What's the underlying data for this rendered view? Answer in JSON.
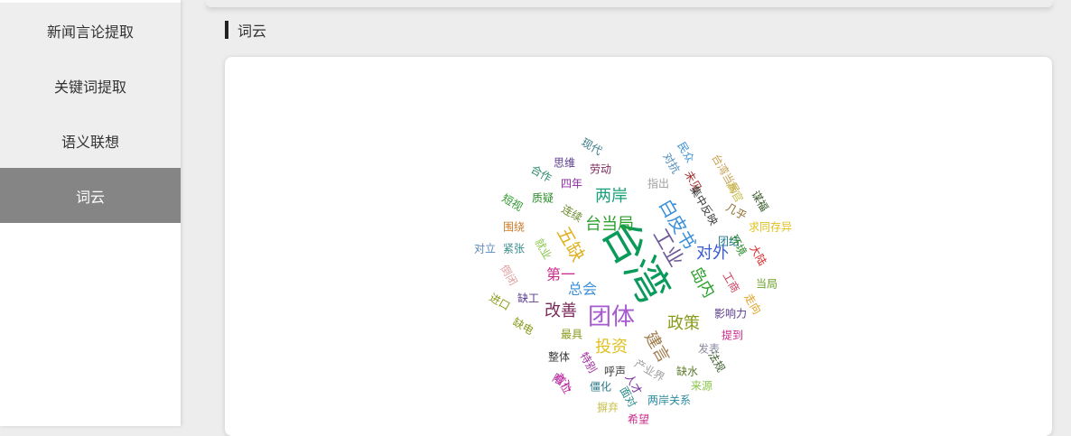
{
  "sidebar": {
    "items": [
      {
        "label": "新闻言论提取"
      },
      {
        "label": "关键词提取"
      },
      {
        "label": "语义联想"
      },
      {
        "label": "词云"
      }
    ]
  },
  "section": {
    "title": "词云"
  },
  "wordcloud": {
    "words": [
      "台湾",
      "团体",
      "工业",
      "白皮书",
      "台当局",
      "两岸",
      "五缺",
      "对外",
      "岛内",
      "政策",
      "建言",
      "投资",
      "改善",
      "总会",
      "第一",
      "现代",
      "民众",
      "思维",
      "劳动",
      "对抗",
      "未见",
      "合作",
      "四年",
      "指出",
      "台湾当局",
      "质疑",
      "集中反映",
      "高官",
      "谋福",
      "短视",
      "连续",
      "几乎",
      "团结",
      "求同存异",
      "围绕",
      "环境",
      "大陆",
      "对立",
      "紧张",
      "倒闭",
      "就业",
      "缺工",
      "工商",
      "当局",
      "进口",
      "走向",
      "缺电",
      "影响力",
      "最具",
      "提到",
      "整体",
      "发表",
      "特别",
      "法规",
      "呼声",
      "人才",
      "产业界",
      "缺水",
      "陷入",
      "僵化",
      "面对",
      "来源",
      "首位",
      "两岸关系",
      "摒弃",
      "希望"
    ]
  }
}
